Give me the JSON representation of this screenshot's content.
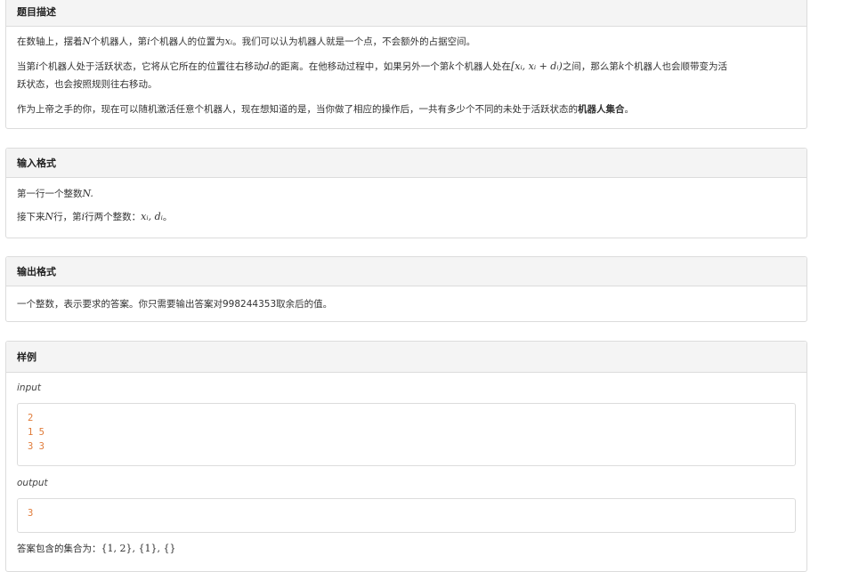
{
  "description": {
    "title": "题目描述",
    "p1": {
      "a": "在数轴上，摆着",
      "N": "N",
      "b": "个机器人，第",
      "i": "i",
      "c": "个机器人的位置为",
      "x": "xᵢ",
      "d": "。我们可以认为机器人就是一个点，不会额外的占据空间。"
    },
    "p2": {
      "a": "当第",
      "i": "i",
      "b": "个机器人处于活跃状态，它将从它所在的位置往右移动",
      "d": "dᵢ",
      "c": "的距离。在他移动过程中，如果另外一个第",
      "k": "k",
      "e": "个机器人处在",
      "range": "[xᵢ, xᵢ + dᵢ)",
      "f": "之间，那么第",
      "k2": "k",
      "g": "个机器人也会顺带变为活",
      "h": "跃状态，也会按照规则往右移动。"
    },
    "p3": {
      "a": "作为上帝之手的你，现在可以随机激活任意个机器人，现在想知道的是，当你做了相应的操作后，一共有多少个不同的未处于活跃状态的",
      "b": "机器人集合",
      "c": "。"
    }
  },
  "input_format": {
    "title": "输入格式",
    "l1": {
      "a": "第一行一个整数",
      "N": "N."
    },
    "l2": {
      "a": "接下来",
      "N": "N",
      "b": "行，第",
      "i": "i",
      "c": "行两个整数：",
      "vars": "xᵢ, dᵢ",
      "d": "。"
    }
  },
  "output_format": {
    "title": "输出格式",
    "l1": "一个整数，表示要求的答案。你只需要输出答案对998244353取余后的值。"
  },
  "sample": {
    "title": "样例",
    "input_label": "input",
    "input_lines": [
      "2",
      "1 5",
      "3 3"
    ],
    "output_label": "output",
    "output_lines": [
      "3"
    ],
    "note_a": "答案包含的集合为：",
    "note_sets": "{1, 2}, {1}, {}"
  }
}
